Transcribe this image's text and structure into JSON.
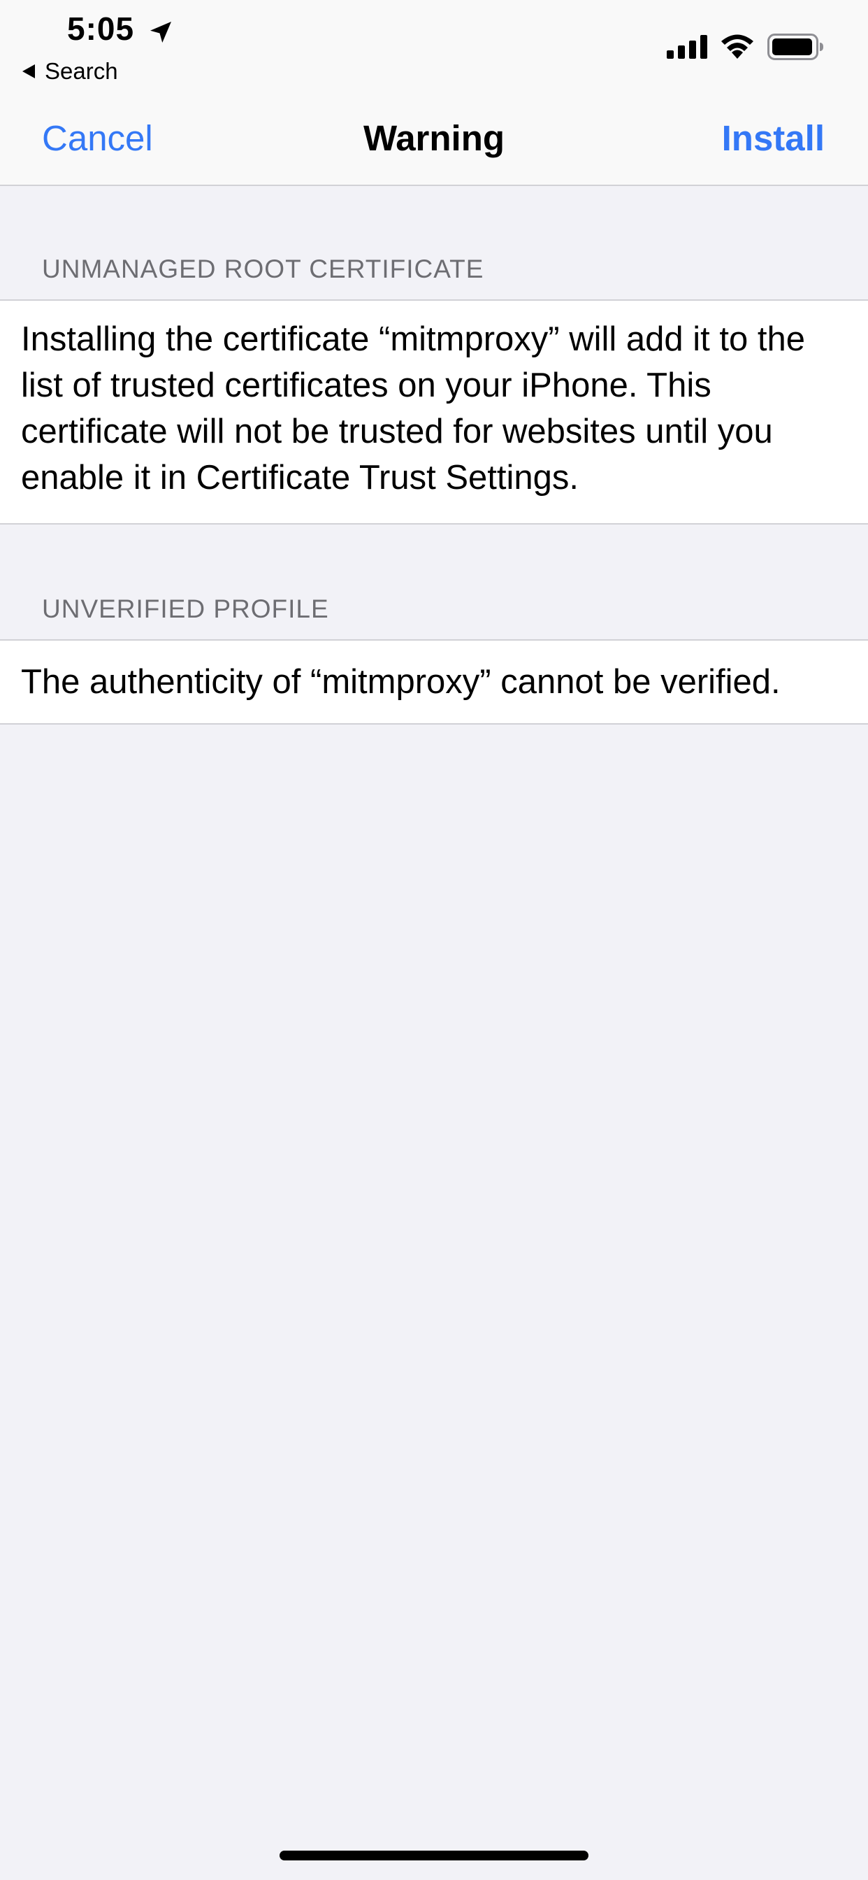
{
  "status_bar": {
    "time": "5:05",
    "back_label": "Search"
  },
  "nav": {
    "cancel_label": "Cancel",
    "title": "Warning",
    "install_label": "Install"
  },
  "sections": [
    {
      "header": "UNMANAGED ROOT CERTIFICATE",
      "body": "Installing the certificate “mitmproxy” will add it to the list of trusted certificates on your iPhone. This certificate will not be trusted for websites until you enable it in Certificate Trust Settings."
    },
    {
      "header": "UNVERIFIED PROFILE",
      "body": "The authenticity of “mitmproxy” cannot be verified."
    }
  ],
  "colors": {
    "accent": "#3478f6",
    "background": "#f2f2f7",
    "header_text": "#6d6d72"
  },
  "icons": [
    "location-arrow-icon",
    "back-triangle-icon",
    "cellular-signal-icon",
    "wifi-icon",
    "battery-icon"
  ]
}
